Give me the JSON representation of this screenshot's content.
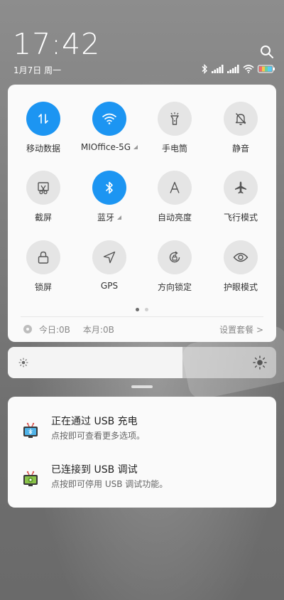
{
  "status": {
    "time": "17:42",
    "date": "1月7日 周一"
  },
  "icons": {
    "search": "search-icon",
    "bluetooth": "bluetooth-icon",
    "signal": "signal-icon",
    "wifi": "wifi-icon",
    "battery": "battery-icon"
  },
  "quick_settings": {
    "tiles": [
      {
        "label": "移动数据",
        "icon": "mobile-data-icon",
        "active": true
      },
      {
        "label": "MIOffice-5G",
        "icon": "wifi-icon",
        "active": true,
        "expandable": true
      },
      {
        "label": "手电筒",
        "icon": "flashlight-icon",
        "active": false
      },
      {
        "label": "静音",
        "icon": "mute-icon",
        "active": false
      },
      {
        "label": "截屏",
        "icon": "screenshot-icon",
        "active": false
      },
      {
        "label": "蓝牙",
        "icon": "bluetooth-icon",
        "active": true,
        "expandable": true
      },
      {
        "label": "自动亮度",
        "icon": "auto-brightness-icon",
        "active": false
      },
      {
        "label": "飞行模式",
        "icon": "airplane-icon",
        "active": false
      },
      {
        "label": "锁屏",
        "icon": "lock-icon",
        "active": false
      },
      {
        "label": "GPS",
        "icon": "gps-icon",
        "active": false
      },
      {
        "label": "方向锁定",
        "icon": "rotation-lock-icon",
        "active": false
      },
      {
        "label": "护眼模式",
        "icon": "eye-icon",
        "active": false
      }
    ],
    "pager": {
      "current": 1,
      "total": 2
    },
    "data_usage": {
      "today": "今日:0B",
      "month": "本月:0B",
      "settings_link": "设置套餐 >"
    }
  },
  "brightness": {
    "level": 0.65
  },
  "notifications": [
    {
      "title": "正在通过 USB 充电",
      "body": "点按即可查看更多选项。",
      "icon": "usb-charging-icon"
    },
    {
      "title": "已连接到 USB 调试",
      "body": "点按即可停用 USB 调试功能。",
      "icon": "usb-debug-icon"
    }
  ],
  "colors": {
    "accent": "#1c95f2",
    "panel": "#fafafa",
    "inactive_tile": "#e5e5e5"
  }
}
